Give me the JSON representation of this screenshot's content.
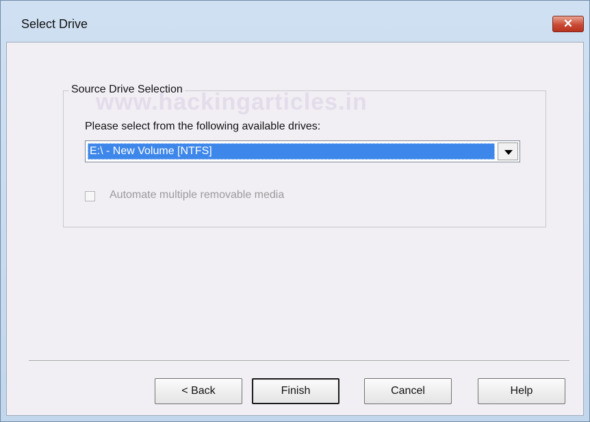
{
  "window": {
    "title": "Select Drive",
    "close_label": "✕"
  },
  "group": {
    "legend": "Source Drive Selection",
    "prompt": "Please select from the following available drives:",
    "selected_drive": "E:\\ - New Volume [NTFS]",
    "checkbox_label": "Automate multiple removable media",
    "checkbox_checked": false,
    "checkbox_enabled": false
  },
  "watermark": "www.hackingarticles.in",
  "buttons": {
    "back": "< Back",
    "finish": "Finish",
    "cancel": "Cancel",
    "help": "Help"
  },
  "colors": {
    "selection": "#3e87ea",
    "close_button": "#c94a34",
    "dialog_background": "#f1eef4"
  }
}
